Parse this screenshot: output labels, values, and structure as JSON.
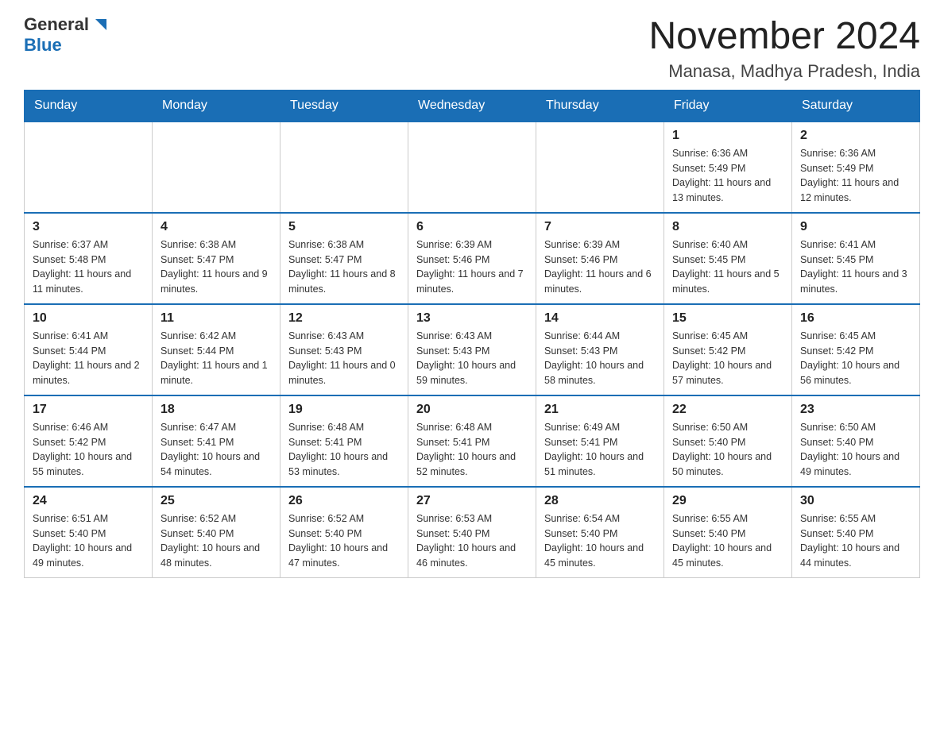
{
  "header": {
    "logo_general": "General",
    "logo_blue": "Blue",
    "month_title": "November 2024",
    "location": "Manasa, Madhya Pradesh, India"
  },
  "days_of_week": [
    "Sunday",
    "Monday",
    "Tuesday",
    "Wednesday",
    "Thursday",
    "Friday",
    "Saturday"
  ],
  "weeks": [
    [
      {
        "day": "",
        "info": ""
      },
      {
        "day": "",
        "info": ""
      },
      {
        "day": "",
        "info": ""
      },
      {
        "day": "",
        "info": ""
      },
      {
        "day": "",
        "info": ""
      },
      {
        "day": "1",
        "info": "Sunrise: 6:36 AM\nSunset: 5:49 PM\nDaylight: 11 hours and 13 minutes."
      },
      {
        "day": "2",
        "info": "Sunrise: 6:36 AM\nSunset: 5:49 PM\nDaylight: 11 hours and 12 minutes."
      }
    ],
    [
      {
        "day": "3",
        "info": "Sunrise: 6:37 AM\nSunset: 5:48 PM\nDaylight: 11 hours and 11 minutes."
      },
      {
        "day": "4",
        "info": "Sunrise: 6:38 AM\nSunset: 5:47 PM\nDaylight: 11 hours and 9 minutes."
      },
      {
        "day": "5",
        "info": "Sunrise: 6:38 AM\nSunset: 5:47 PM\nDaylight: 11 hours and 8 minutes."
      },
      {
        "day": "6",
        "info": "Sunrise: 6:39 AM\nSunset: 5:46 PM\nDaylight: 11 hours and 7 minutes."
      },
      {
        "day": "7",
        "info": "Sunrise: 6:39 AM\nSunset: 5:46 PM\nDaylight: 11 hours and 6 minutes."
      },
      {
        "day": "8",
        "info": "Sunrise: 6:40 AM\nSunset: 5:45 PM\nDaylight: 11 hours and 5 minutes."
      },
      {
        "day": "9",
        "info": "Sunrise: 6:41 AM\nSunset: 5:45 PM\nDaylight: 11 hours and 3 minutes."
      }
    ],
    [
      {
        "day": "10",
        "info": "Sunrise: 6:41 AM\nSunset: 5:44 PM\nDaylight: 11 hours and 2 minutes."
      },
      {
        "day": "11",
        "info": "Sunrise: 6:42 AM\nSunset: 5:44 PM\nDaylight: 11 hours and 1 minute."
      },
      {
        "day": "12",
        "info": "Sunrise: 6:43 AM\nSunset: 5:43 PM\nDaylight: 11 hours and 0 minutes."
      },
      {
        "day": "13",
        "info": "Sunrise: 6:43 AM\nSunset: 5:43 PM\nDaylight: 10 hours and 59 minutes."
      },
      {
        "day": "14",
        "info": "Sunrise: 6:44 AM\nSunset: 5:43 PM\nDaylight: 10 hours and 58 minutes."
      },
      {
        "day": "15",
        "info": "Sunrise: 6:45 AM\nSunset: 5:42 PM\nDaylight: 10 hours and 57 minutes."
      },
      {
        "day": "16",
        "info": "Sunrise: 6:45 AM\nSunset: 5:42 PM\nDaylight: 10 hours and 56 minutes."
      }
    ],
    [
      {
        "day": "17",
        "info": "Sunrise: 6:46 AM\nSunset: 5:42 PM\nDaylight: 10 hours and 55 minutes."
      },
      {
        "day": "18",
        "info": "Sunrise: 6:47 AM\nSunset: 5:41 PM\nDaylight: 10 hours and 54 minutes."
      },
      {
        "day": "19",
        "info": "Sunrise: 6:48 AM\nSunset: 5:41 PM\nDaylight: 10 hours and 53 minutes."
      },
      {
        "day": "20",
        "info": "Sunrise: 6:48 AM\nSunset: 5:41 PM\nDaylight: 10 hours and 52 minutes."
      },
      {
        "day": "21",
        "info": "Sunrise: 6:49 AM\nSunset: 5:41 PM\nDaylight: 10 hours and 51 minutes."
      },
      {
        "day": "22",
        "info": "Sunrise: 6:50 AM\nSunset: 5:40 PM\nDaylight: 10 hours and 50 minutes."
      },
      {
        "day": "23",
        "info": "Sunrise: 6:50 AM\nSunset: 5:40 PM\nDaylight: 10 hours and 49 minutes."
      }
    ],
    [
      {
        "day": "24",
        "info": "Sunrise: 6:51 AM\nSunset: 5:40 PM\nDaylight: 10 hours and 49 minutes."
      },
      {
        "day": "25",
        "info": "Sunrise: 6:52 AM\nSunset: 5:40 PM\nDaylight: 10 hours and 48 minutes."
      },
      {
        "day": "26",
        "info": "Sunrise: 6:52 AM\nSunset: 5:40 PM\nDaylight: 10 hours and 47 minutes."
      },
      {
        "day": "27",
        "info": "Sunrise: 6:53 AM\nSunset: 5:40 PM\nDaylight: 10 hours and 46 minutes."
      },
      {
        "day": "28",
        "info": "Sunrise: 6:54 AM\nSunset: 5:40 PM\nDaylight: 10 hours and 45 minutes."
      },
      {
        "day": "29",
        "info": "Sunrise: 6:55 AM\nSunset: 5:40 PM\nDaylight: 10 hours and 45 minutes."
      },
      {
        "day": "30",
        "info": "Sunrise: 6:55 AM\nSunset: 5:40 PM\nDaylight: 10 hours and 44 minutes."
      }
    ]
  ]
}
